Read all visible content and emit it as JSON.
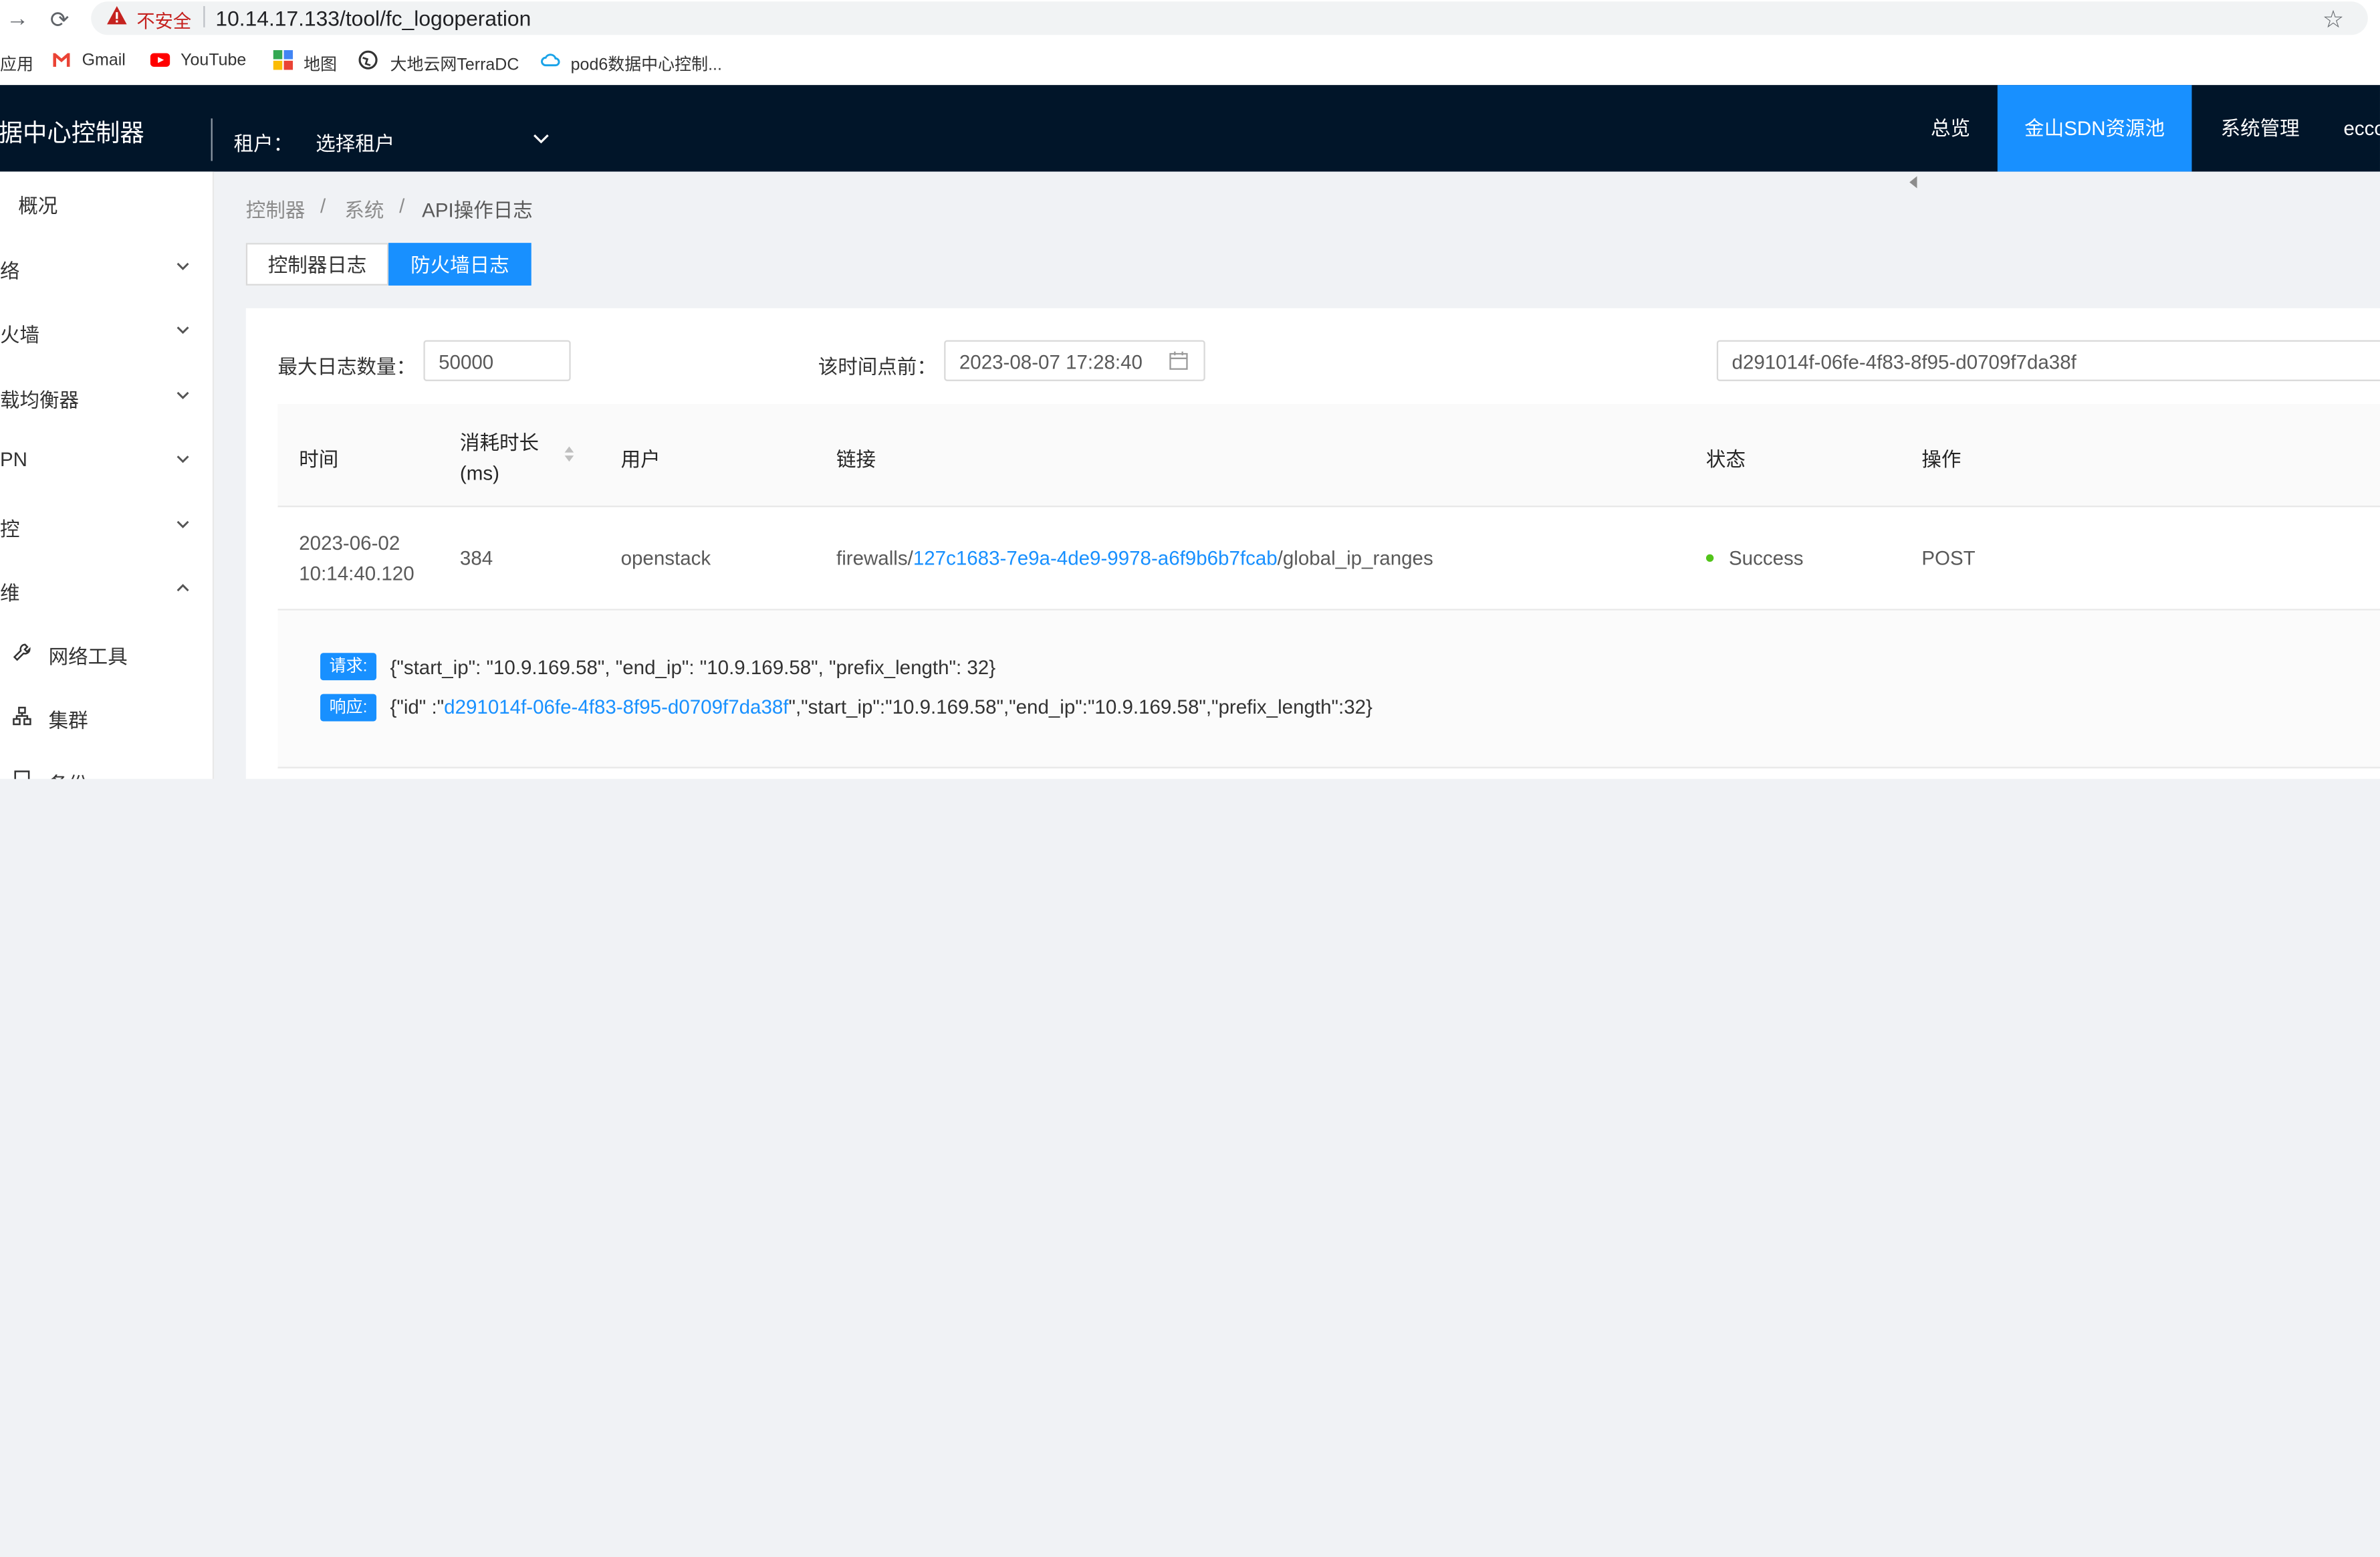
{
  "browser": {
    "insecure_label": "不安全",
    "url": "10.14.17.133/tool/fc_logoperation",
    "bookmarks": [
      {
        "label": "应用"
      },
      {
        "label": "Gmail"
      },
      {
        "label": "YouTube"
      },
      {
        "label": "地图"
      },
      {
        "label": "大地云网TerraDC"
      },
      {
        "label": "pod6数据中心控制..."
      }
    ]
  },
  "header": {
    "app_title": "数据中心控制器",
    "tenant_label": "租户：",
    "tenant_placeholder": "选择租户",
    "nav": [
      {
        "label": "总览",
        "active": false
      },
      {
        "label": "金山SDN资源池",
        "active": true
      },
      {
        "label": "系统管理",
        "active": false
      },
      {
        "label": "ecco",
        "active": false
      }
    ],
    "accent_color": "#1890ff",
    "bg_color": "#011529"
  },
  "sidebar": {
    "items": [
      {
        "label": "概况",
        "expandable": false
      },
      {
        "label": "络",
        "expandable": true,
        "expanded": false
      },
      {
        "label": "火墙",
        "expandable": true,
        "expanded": false
      },
      {
        "label": "载均衡器",
        "expandable": true,
        "expanded": false
      },
      {
        "label": "PN",
        "expandable": true,
        "expanded": false
      },
      {
        "label": "控",
        "expandable": true,
        "expanded": false
      },
      {
        "label": "维",
        "expandable": true,
        "expanded": true
      }
    ],
    "sub_items": [
      {
        "label": "网络工具",
        "icon": "wrench-icon"
      },
      {
        "label": "集群",
        "icon": "cluster-icon"
      },
      {
        "label": "备份",
        "icon": "backup-icon"
      }
    ]
  },
  "breadcrumb": {
    "items": [
      "控制器",
      "系统",
      "API操作日志"
    ],
    "separator": "/"
  },
  "tabs": [
    {
      "label": "控制器日志",
      "active": false
    },
    {
      "label": "防火墙日志",
      "active": true
    }
  ],
  "filters": {
    "max_label": "最大日志数量：",
    "max_value": "50000",
    "time_label": "该时间点前：",
    "time_value": "2023-08-07 17:28:40",
    "search_value": "d291014f-06fe-4f83-8f95-d0709f7da38f"
  },
  "table": {
    "columns": [
      "时间",
      "消耗时长\n(ms)",
      "用户",
      "链接",
      "状态",
      "操作"
    ],
    "rows": [
      {
        "time_date": "2023-06-02",
        "time_clock": "10:14:40.120",
        "duration": "384",
        "user": "openstack",
        "link_prefix": "firewalls/",
        "link_id": "127c1683-7e9a-4de9-9978-a6f9b6b7fcab",
        "link_suffix": "/global_ip_ranges",
        "status": "Success",
        "status_color": "#52c41a",
        "method": "POST"
      }
    ]
  },
  "expanded": {
    "request_tag": "请求:",
    "request_body": "{\"start_ip\": \"10.9.169.58\", \"end_ip\": \"10.9.169.58\", \"prefix_length\": 32}",
    "response_tag": "响应:",
    "response_prefix": "{\"id\" :\"",
    "response_id": "d291014f-06fe-4f83-8f95-d0709f7da38f",
    "response_suffix": "\",\"start_ip\":\"10.9.169.58\",\"end_ip\":\"10.9.169.58\",\"prefix_length\":32}"
  }
}
